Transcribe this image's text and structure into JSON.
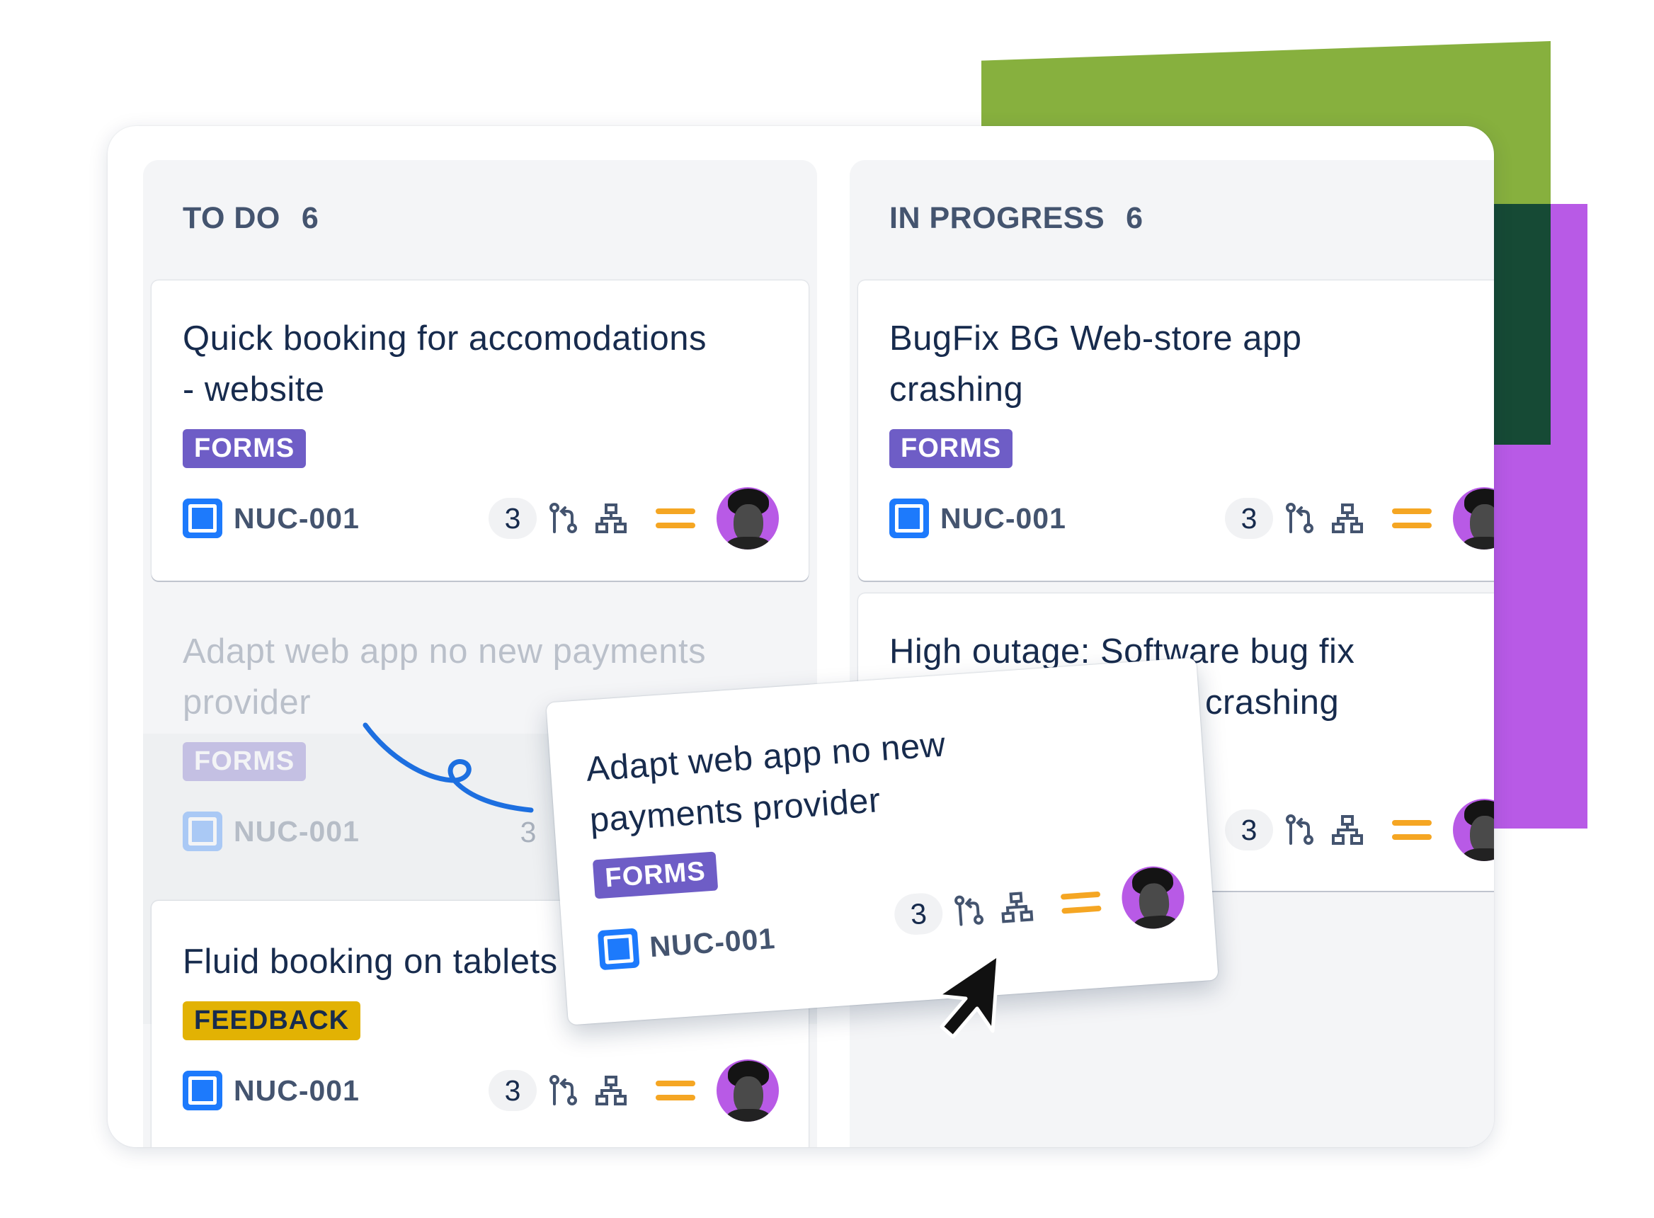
{
  "colors": {
    "accent": "#1d7afc",
    "forms_label": "#6e5dc6",
    "feedback_label": "#e2b203",
    "priority": "#f5a623",
    "deco_green": "#87b03e",
    "deco_dark_green": "#164a35",
    "deco_purple": "#b85ae6"
  },
  "icons": [
    "story-icon",
    "pull-request-icon",
    "hierarchy-icon",
    "priority-medium-icon",
    "avatar",
    "cursor-arrow-icon"
  ],
  "columns": [
    {
      "title": "TO DO",
      "count": "6",
      "cards": [
        {
          "title": "Quick booking for accomodations - website",
          "label": "FORMS",
          "issue_key": "NUC-001",
          "comment_count": "3"
        },
        {
          "title": "Adapt web app no new payments provider",
          "label": "FORMS",
          "issue_key": "NUC-001",
          "comment_count": "3"
        },
        {
          "title": "Fluid booking on tablets",
          "label": "FEEDBACK",
          "issue_key": "NUC-001",
          "comment_count": "3"
        }
      ]
    },
    {
      "title": "IN PROGRESS",
      "count": "6",
      "cards": [
        {
          "title": "BugFix BG Web-store app crashing",
          "label": "FORMS",
          "issue_key": "NUC-001",
          "comment_count": "3"
        },
        {
          "title_line1": "High outage: Software bug fix",
          "title_line2_visible": "crashing",
          "comment_count": "3"
        }
      ]
    }
  ],
  "dragged_card": {
    "title": "Adapt web app no new payments provider",
    "label": "FORMS",
    "issue_key": "NUC-001",
    "comment_count": "3"
  }
}
